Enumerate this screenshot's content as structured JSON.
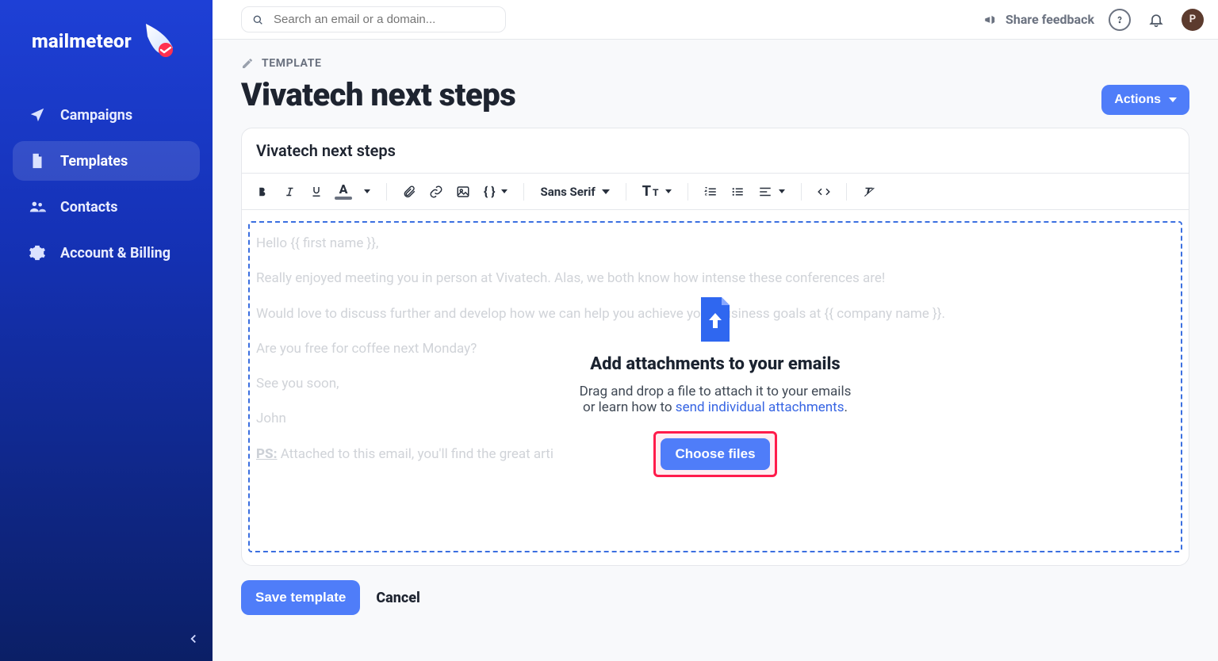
{
  "brand": {
    "name": "mailmeteor"
  },
  "sidebar": {
    "items": [
      {
        "label": "Campaigns"
      },
      {
        "label": "Templates"
      },
      {
        "label": "Contacts"
      },
      {
        "label": "Account & Billing"
      }
    ]
  },
  "topbar": {
    "search_placeholder": "Search an email or a domain...",
    "feedback_label": "Share feedback",
    "avatar_initial": "P"
  },
  "page": {
    "crumb": "TEMPLATE",
    "title": "Vivatech next steps",
    "actions_label": "Actions"
  },
  "editor": {
    "subject": "Vivatech next steps",
    "font_family_label": "Sans Serif",
    "body": {
      "p1": "Hello {{ first name }},",
      "p2": "Really enjoyed meeting you in person at Vivatech. Alas, we both know how intense these conferences are!",
      "p3": "Would love to discuss further and develop how we can help you achieve your business goals at {{ company name }}.",
      "p4": "Are you free for coffee next Monday?",
      "p5": "See you soon,",
      "p6": "John",
      "ps_prefix": "PS:",
      "ps_rest": " Attached to this email, you'll find the great arti"
    }
  },
  "drop": {
    "title": "Add attachments to your emails",
    "line1": "Drag and drop a file to attach it to your emails",
    "line2_prefix": "or learn how to ",
    "line2_link": "send individual attachments",
    "line2_suffix": ".",
    "choose_label": "Choose files"
  },
  "footer": {
    "save_label": "Save template",
    "cancel_label": "Cancel"
  },
  "colors": {
    "primary": "#4f7df9",
    "accent": "#ff1b4b",
    "sidebar_gradient_from": "#1e40d6",
    "sidebar_gradient_to": "#0b1f66"
  }
}
